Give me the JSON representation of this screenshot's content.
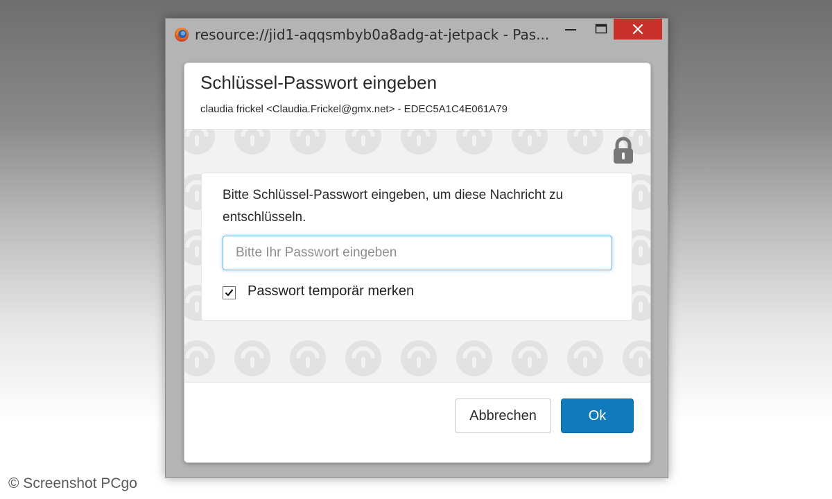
{
  "window": {
    "title": "resource://jid1-aqqsmbyb0a8adg-at-jetpack - Pas...",
    "app_icon": "firefox-icon",
    "controls": {
      "minimize_icon": "minimize-icon",
      "maximize_icon": "maximize-icon",
      "close_icon": "close-icon"
    }
  },
  "dialog": {
    "title": "Schlüssel-Passwort eingeben",
    "subtitle": "claudia frickel <Claudia.Frickel@gmx.net> - EDEC5A1C4E061A79",
    "lock_icon": "lock-icon",
    "background_pattern_icon": "lock-pattern-icon",
    "message": "Bitte Schlüssel-Passwort eingeben, um diese Nachricht zu entschlüsseln.",
    "password": {
      "value": "",
      "placeholder": "Bitte Ihr Passwort eingeben"
    },
    "remember": {
      "checked": true,
      "label": "Passwort temporär merken"
    },
    "buttons": {
      "cancel_label": "Abbrechen",
      "ok_label": "Ok"
    }
  },
  "watermark": "© Screenshot PCgo",
  "colors": {
    "close_button": "#c7312a",
    "ok_button": "#0f7bbc",
    "input_focus": "#66afe9"
  }
}
